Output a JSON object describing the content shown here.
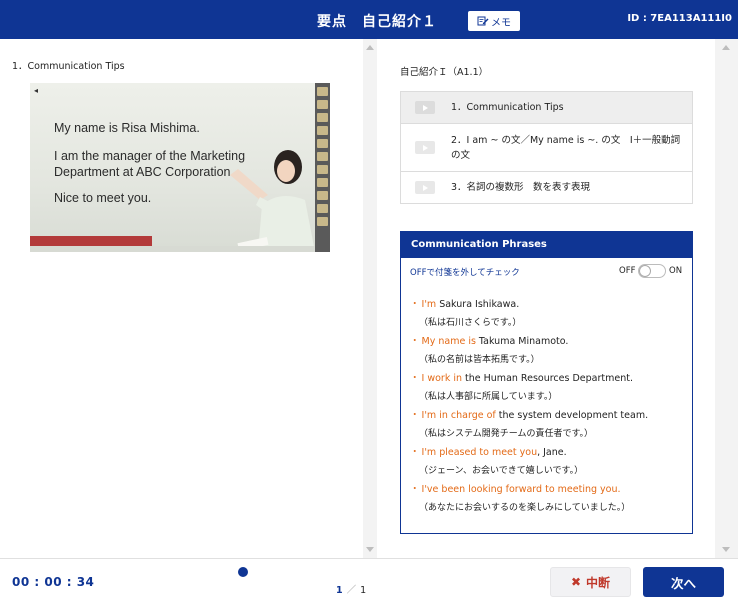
{
  "header": {
    "title": "要点　自己紹介１",
    "memo_label": "メモ",
    "id_text": "ID : 7EA113A111I0"
  },
  "left": {
    "section_label": "1．Communication Tips",
    "video": {
      "slide_line1": "My name is Risa Mishima.",
      "slide_line2": "I am the manager of the Marketing Department at ABC Corporation.",
      "slide_line3": "Nice to meet you."
    }
  },
  "right": {
    "lesson_title": "自己紹介Ｉ（A1.1）",
    "toc": [
      {
        "label": "1．Communication Tips"
      },
      {
        "label": "2．I am ~ の文／My name is ~. の文　I＋一般動詞の文"
      },
      {
        "label": "3．名詞の複数形　数を表す表現"
      }
    ],
    "phrases": {
      "heading": "Communication Phrases",
      "toggle_hint": "OFFで付箋を外してチェック",
      "off_label": "OFF",
      "on_label": "ON",
      "items": [
        {
          "bullet": "・",
          "hl": "I'm",
          "rest": " Sakura Ishikawa.",
          "ja": "（私は石川さくらです。）"
        },
        {
          "bullet": "・",
          "hl": "My name is",
          "rest": " Takuma Minamoto.",
          "ja": "（私の名前は皆本拓馬です。）"
        },
        {
          "bullet": "・",
          "hl": "I work in",
          "rest": " the Human Resources Department.",
          "ja": "（私は人事部に所属しています。）"
        },
        {
          "bullet": "・",
          "hl": "I'm in charge of",
          "rest": " the system development team.",
          "ja": "（私はシステム開発チームの責任者です。）"
        },
        {
          "bullet": "・",
          "hl": "I'm pleased to meet you",
          "rest": ", Jane.",
          "ja": "（ジェーン、お会いできて嬉しいです。）"
        },
        {
          "bullet": "・",
          "hl": "I've been looking forward to meeting you.",
          "rest": "",
          "ja": "（あなたにお会いするのを楽しみにしていました。）"
        }
      ]
    }
  },
  "footer": {
    "timer": "00 : 00 : 34",
    "page_current": "1",
    "page_separator": "／",
    "page_total": "1",
    "suspend_label": "中断",
    "next_label": "次へ"
  },
  "colors": {
    "brand_blue": "#0f3594",
    "highlight_orange": "#e36a17",
    "suspend_red": "#c0392b"
  }
}
